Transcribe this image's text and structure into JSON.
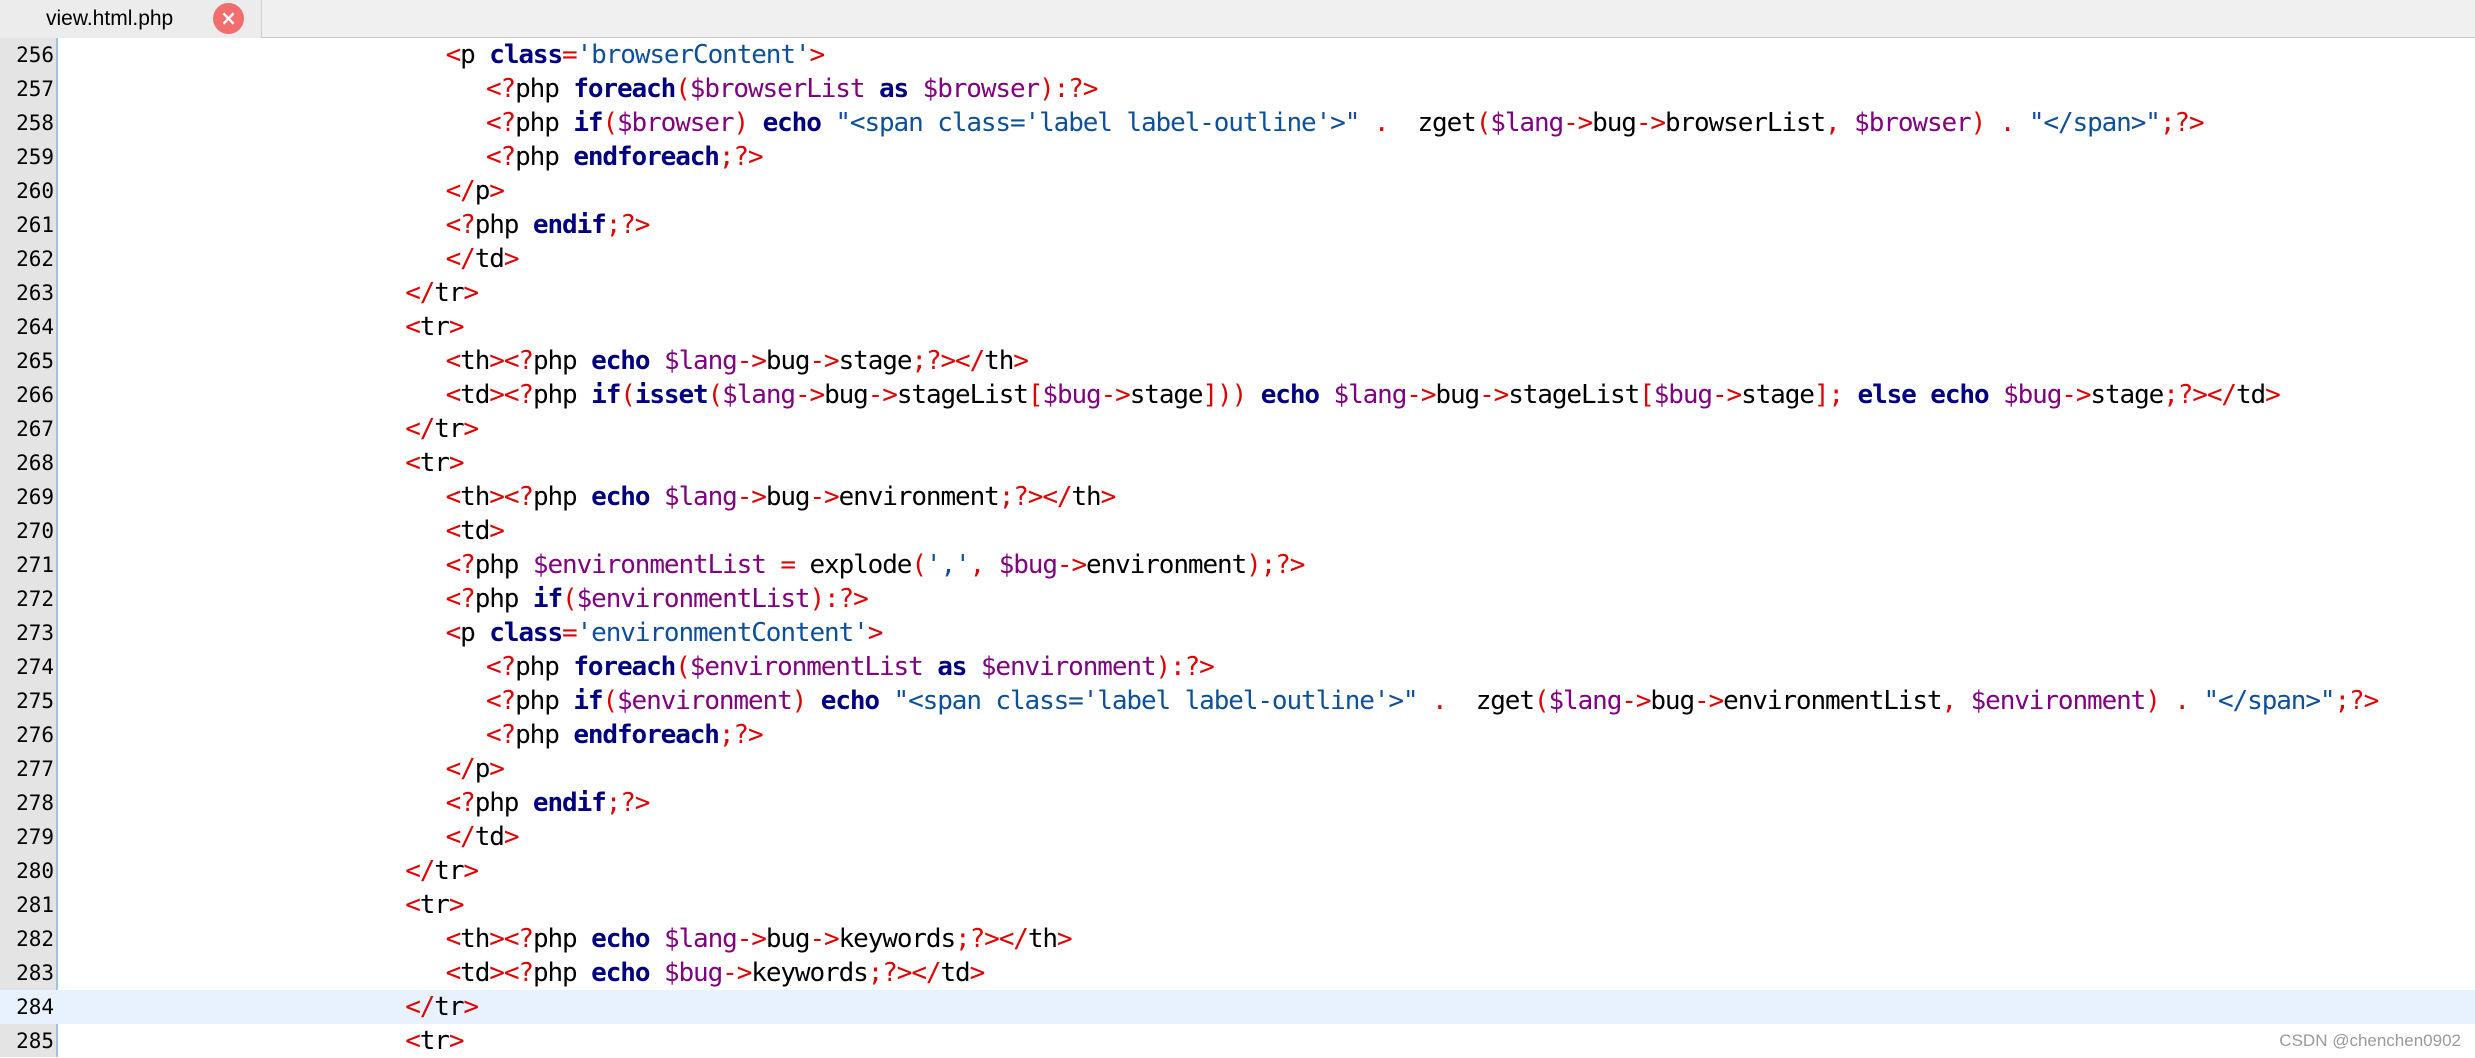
{
  "tab": {
    "title": "view.html.php",
    "close_icon": "×"
  },
  "current_line": 284,
  "lines": [
    {
      "n": "256",
      "indent": 9,
      "tokens": [
        [
          "p",
          "<"
        ],
        [
          "t",
          "p "
        ],
        [
          "k",
          "class"
        ],
        [
          "p",
          "="
        ],
        [
          "s",
          "'browserContent'"
        ],
        [
          "p",
          ">"
        ]
      ]
    },
    {
      "n": "257",
      "indent": 10,
      "tokens": [
        [
          "p",
          "<?"
        ],
        [
          "t",
          "php "
        ],
        [
          "k",
          "foreach"
        ],
        [
          "p",
          "("
        ],
        [
          "v",
          "$browserList"
        ],
        [
          "t",
          " "
        ],
        [
          "k",
          "as"
        ],
        [
          "t",
          " "
        ],
        [
          "v",
          "$browser"
        ],
        [
          "p",
          "):?>"
        ]
      ]
    },
    {
      "n": "258",
      "indent": 10,
      "tokens": [
        [
          "p",
          "<?"
        ],
        [
          "t",
          "php "
        ],
        [
          "k",
          "if"
        ],
        [
          "p",
          "("
        ],
        [
          "v",
          "$browser"
        ],
        [
          "p",
          ")"
        ],
        [
          "t",
          " "
        ],
        [
          "k",
          "echo"
        ],
        [
          "t",
          " "
        ],
        [
          "s",
          "\"<span class='label label-outline'>\""
        ],
        [
          "t",
          " "
        ],
        [
          "p",
          "."
        ],
        [
          "t",
          "  zget"
        ],
        [
          "p",
          "("
        ],
        [
          "v",
          "$lang"
        ],
        [
          "p",
          "->"
        ],
        [
          "t",
          "bug"
        ],
        [
          "p",
          "->"
        ],
        [
          "t",
          "browserList"
        ],
        [
          "p",
          ","
        ],
        [
          "t",
          " "
        ],
        [
          "v",
          "$browser"
        ],
        [
          "p",
          ")"
        ],
        [
          "t",
          " "
        ],
        [
          "p",
          "."
        ],
        [
          "t",
          " "
        ],
        [
          "s",
          "\"</span>\""
        ],
        [
          "p",
          ";?>"
        ]
      ]
    },
    {
      "n": "259",
      "indent": 10,
      "tokens": [
        [
          "p",
          "<?"
        ],
        [
          "t",
          "php "
        ],
        [
          "k",
          "endforeach"
        ],
        [
          "p",
          ";?>"
        ]
      ]
    },
    {
      "n": "260",
      "indent": 9,
      "tokens": [
        [
          "p",
          "</"
        ],
        [
          "t",
          "p"
        ],
        [
          "p",
          ">"
        ]
      ]
    },
    {
      "n": "261",
      "indent": 9,
      "tokens": [
        [
          "p",
          "<?"
        ],
        [
          "t",
          "php "
        ],
        [
          "k",
          "endif"
        ],
        [
          "p",
          ";?>"
        ]
      ]
    },
    {
      "n": "262",
      "indent": 9,
      "tokens": [
        [
          "p",
          "</"
        ],
        [
          "t",
          "td"
        ],
        [
          "p",
          ">"
        ]
      ]
    },
    {
      "n": "263",
      "indent": 8,
      "tokens": [
        [
          "p",
          "</"
        ],
        [
          "t",
          "tr"
        ],
        [
          "p",
          ">"
        ]
      ]
    },
    {
      "n": "264",
      "indent": 8,
      "tokens": [
        [
          "p",
          "<"
        ],
        [
          "t",
          "tr"
        ],
        [
          "p",
          ">"
        ]
      ]
    },
    {
      "n": "265",
      "indent": 9,
      "tokens": [
        [
          "p",
          "<"
        ],
        [
          "t",
          "th"
        ],
        [
          "p",
          "><?"
        ],
        [
          "t",
          "php "
        ],
        [
          "k",
          "echo"
        ],
        [
          "t",
          " "
        ],
        [
          "v",
          "$lang"
        ],
        [
          "p",
          "->"
        ],
        [
          "t",
          "bug"
        ],
        [
          "p",
          "->"
        ],
        [
          "t",
          "stage"
        ],
        [
          "p",
          ";?></"
        ],
        [
          "t",
          "th"
        ],
        [
          "p",
          ">"
        ]
      ]
    },
    {
      "n": "266",
      "indent": 9,
      "tokens": [
        [
          "p",
          "<"
        ],
        [
          "t",
          "td"
        ],
        [
          "p",
          "><?"
        ],
        [
          "t",
          "php "
        ],
        [
          "k",
          "if"
        ],
        [
          "p",
          "("
        ],
        [
          "k",
          "isset"
        ],
        [
          "p",
          "("
        ],
        [
          "v",
          "$lang"
        ],
        [
          "p",
          "->"
        ],
        [
          "t",
          "bug"
        ],
        [
          "p",
          "->"
        ],
        [
          "t",
          "stageList"
        ],
        [
          "p",
          "["
        ],
        [
          "v",
          "$bug"
        ],
        [
          "p",
          "->"
        ],
        [
          "t",
          "stage"
        ],
        [
          "p",
          "]))"
        ],
        [
          "t",
          " "
        ],
        [
          "k",
          "echo"
        ],
        [
          "t",
          " "
        ],
        [
          "v",
          "$lang"
        ],
        [
          "p",
          "->"
        ],
        [
          "t",
          "bug"
        ],
        [
          "p",
          "->"
        ],
        [
          "t",
          "stageList"
        ],
        [
          "p",
          "["
        ],
        [
          "v",
          "$bug"
        ],
        [
          "p",
          "->"
        ],
        [
          "t",
          "stage"
        ],
        [
          "p",
          "];"
        ],
        [
          "t",
          " "
        ],
        [
          "k",
          "else"
        ],
        [
          "t",
          " "
        ],
        [
          "k",
          "echo"
        ],
        [
          "t",
          " "
        ],
        [
          "v",
          "$bug"
        ],
        [
          "p",
          "->"
        ],
        [
          "t",
          "stage"
        ],
        [
          "p",
          ";?></"
        ],
        [
          "t",
          "td"
        ],
        [
          "p",
          ">"
        ]
      ]
    },
    {
      "n": "267",
      "indent": 8,
      "tokens": [
        [
          "p",
          "</"
        ],
        [
          "t",
          "tr"
        ],
        [
          "p",
          ">"
        ]
      ]
    },
    {
      "n": "268",
      "indent": 8,
      "tokens": [
        [
          "p",
          "<"
        ],
        [
          "t",
          "tr"
        ],
        [
          "p",
          ">"
        ]
      ]
    },
    {
      "n": "269",
      "indent": 9,
      "tokens": [
        [
          "p",
          "<"
        ],
        [
          "t",
          "th"
        ],
        [
          "p",
          "><?"
        ],
        [
          "t",
          "php "
        ],
        [
          "k",
          "echo"
        ],
        [
          "t",
          " "
        ],
        [
          "v",
          "$lang"
        ],
        [
          "p",
          "->"
        ],
        [
          "t",
          "bug"
        ],
        [
          "p",
          "->"
        ],
        [
          "t",
          "environment"
        ],
        [
          "p",
          ";?></"
        ],
        [
          "t",
          "th"
        ],
        [
          "p",
          ">"
        ]
      ]
    },
    {
      "n": "270",
      "indent": 9,
      "tokens": [
        [
          "p",
          "<"
        ],
        [
          "t",
          "td"
        ],
        [
          "p",
          ">"
        ]
      ]
    },
    {
      "n": "271",
      "indent": 9,
      "tokens": [
        [
          "p",
          "<?"
        ],
        [
          "t",
          "php "
        ],
        [
          "v",
          "$environmentList"
        ],
        [
          "t",
          " "
        ],
        [
          "p",
          "="
        ],
        [
          "t",
          " explode"
        ],
        [
          "p",
          "("
        ],
        [
          "s",
          "','"
        ],
        [
          "p",
          ","
        ],
        [
          "t",
          " "
        ],
        [
          "v",
          "$bug"
        ],
        [
          "p",
          "->"
        ],
        [
          "t",
          "environment"
        ],
        [
          "p",
          ");?>"
        ]
      ]
    },
    {
      "n": "272",
      "indent": 9,
      "tokens": [
        [
          "p",
          "<?"
        ],
        [
          "t",
          "php "
        ],
        [
          "k",
          "if"
        ],
        [
          "p",
          "("
        ],
        [
          "v",
          "$environmentList"
        ],
        [
          "p",
          "):?>"
        ]
      ]
    },
    {
      "n": "273",
      "indent": 9,
      "tokens": [
        [
          "p",
          "<"
        ],
        [
          "t",
          "p "
        ],
        [
          "k",
          "class"
        ],
        [
          "p",
          "="
        ],
        [
          "s",
          "'environmentContent'"
        ],
        [
          "p",
          ">"
        ]
      ]
    },
    {
      "n": "274",
      "indent": 10,
      "tokens": [
        [
          "p",
          "<?"
        ],
        [
          "t",
          "php "
        ],
        [
          "k",
          "foreach"
        ],
        [
          "p",
          "("
        ],
        [
          "v",
          "$environmentList"
        ],
        [
          "t",
          " "
        ],
        [
          "k",
          "as"
        ],
        [
          "t",
          " "
        ],
        [
          "v",
          "$environment"
        ],
        [
          "p",
          "):?>"
        ]
      ]
    },
    {
      "n": "275",
      "indent": 10,
      "tokens": [
        [
          "p",
          "<?"
        ],
        [
          "t",
          "php "
        ],
        [
          "k",
          "if"
        ],
        [
          "p",
          "("
        ],
        [
          "v",
          "$environment"
        ],
        [
          "p",
          ")"
        ],
        [
          "t",
          " "
        ],
        [
          "k",
          "echo"
        ],
        [
          "t",
          " "
        ],
        [
          "s",
          "\"<span class='label label-outline'>\""
        ],
        [
          "t",
          " "
        ],
        [
          "p",
          "."
        ],
        [
          "t",
          "  zget"
        ],
        [
          "p",
          "("
        ],
        [
          "v",
          "$lang"
        ],
        [
          "p",
          "->"
        ],
        [
          "t",
          "bug"
        ],
        [
          "p",
          "->"
        ],
        [
          "t",
          "environmentList"
        ],
        [
          "p",
          ","
        ],
        [
          "t",
          " "
        ],
        [
          "v",
          "$environment"
        ],
        [
          "p",
          ")"
        ],
        [
          "t",
          " "
        ],
        [
          "p",
          "."
        ],
        [
          "t",
          " "
        ],
        [
          "s",
          "\"</span>\""
        ],
        [
          "p",
          ";?>"
        ]
      ]
    },
    {
      "n": "276",
      "indent": 10,
      "tokens": [
        [
          "p",
          "<?"
        ],
        [
          "t",
          "php "
        ],
        [
          "k",
          "endforeach"
        ],
        [
          "p",
          ";?>"
        ]
      ]
    },
    {
      "n": "277",
      "indent": 9,
      "tokens": [
        [
          "p",
          "</"
        ],
        [
          "t",
          "p"
        ],
        [
          "p",
          ">"
        ]
      ]
    },
    {
      "n": "278",
      "indent": 9,
      "tokens": [
        [
          "p",
          "<?"
        ],
        [
          "t",
          "php "
        ],
        [
          "k",
          "endif"
        ],
        [
          "p",
          ";?>"
        ]
      ]
    },
    {
      "n": "279",
      "indent": 9,
      "tokens": [
        [
          "p",
          "</"
        ],
        [
          "t",
          "td"
        ],
        [
          "p",
          ">"
        ]
      ]
    },
    {
      "n": "280",
      "indent": 8,
      "tokens": [
        [
          "p",
          "</"
        ],
        [
          "t",
          "tr"
        ],
        [
          "p",
          ">"
        ]
      ]
    },
    {
      "n": "281",
      "indent": 8,
      "tokens": [
        [
          "p",
          "<"
        ],
        [
          "t",
          "tr"
        ],
        [
          "p",
          ">"
        ]
      ]
    },
    {
      "n": "282",
      "indent": 9,
      "tokens": [
        [
          "p",
          "<"
        ],
        [
          "t",
          "th"
        ],
        [
          "p",
          "><?"
        ],
        [
          "t",
          "php "
        ],
        [
          "k",
          "echo"
        ],
        [
          "t",
          " "
        ],
        [
          "v",
          "$lang"
        ],
        [
          "p",
          "->"
        ],
        [
          "t",
          "bug"
        ],
        [
          "p",
          "->"
        ],
        [
          "t",
          "keywords"
        ],
        [
          "p",
          ";?></"
        ],
        [
          "t",
          "th"
        ],
        [
          "p",
          ">"
        ]
      ]
    },
    {
      "n": "283",
      "indent": 9,
      "tokens": [
        [
          "p",
          "<"
        ],
        [
          "t",
          "td"
        ],
        [
          "p",
          "><?"
        ],
        [
          "t",
          "php "
        ],
        [
          "k",
          "echo"
        ],
        [
          "t",
          " "
        ],
        [
          "v",
          "$bug"
        ],
        [
          "p",
          "->"
        ],
        [
          "t",
          "keywords"
        ],
        [
          "p",
          ";?></"
        ],
        [
          "t",
          "td"
        ],
        [
          "p",
          ">"
        ]
      ]
    },
    {
      "n": "284",
      "indent": 8,
      "tokens": [
        [
          "p",
          "</"
        ],
        [
          "t",
          "tr"
        ],
        [
          "p",
          ">"
        ]
      ]
    },
    {
      "n": "285",
      "indent": 8,
      "tokens": [
        [
          "p",
          "<"
        ],
        [
          "t",
          "tr"
        ],
        [
          "p",
          ">"
        ]
      ]
    }
  ],
  "watermark": "CSDN @chenchen0902"
}
